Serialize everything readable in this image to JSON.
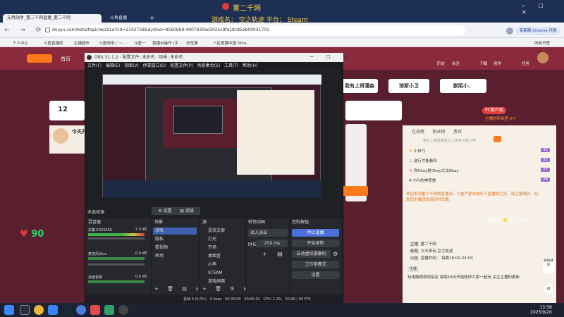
{
  "browser": {
    "tabs": [
      {
        "label": "无燃战争_董二千网直播_董二千网",
        "active": true
      },
      {
        "label": "斗鱼直播",
        "active": false
      }
    ],
    "url": "douyu.com/beta/topic/wjzz1a?rid=2142758&dyshid=85606b8-4907930ac5025c9fa18c85ab00031701",
    "profile_label": "有新版 Chrome 可用",
    "bookmarks": [
      "个人中心",
      "斗鱼直播间",
      "主播超市",
      "斗鱼网络 | '~'...",
      "斗鱼一",
      "我播云操作 (手...",
      "浏览器",
      "八位室播中国 XPro...",
      "所有书签"
    ]
  },
  "overlay": {
    "brand": "董二千网",
    "line": "游戏名： 空之轨迹 平台： Steam"
  },
  "douyu": {
    "nav": {
      "home": "首页",
      "right_icons": [
        "历史",
        "关注",
        "下载",
        "创作",
        "任务"
      ]
    },
    "tags": [
      "我有上将潘森",
      "琼斯小卫",
      "默陌小、"
    ],
    "room_title": "今天开",
    "room_count": "12",
    "room_id_badge": "PC客户端",
    "side_label": "主播的粉丝团 0/7",
    "heart_count": "90",
    "side_heart": "90"
  },
  "obs": {
    "title": "OBS 31.1.2 - 配置文件: 未命名 - 场景: 未命名",
    "menu": [
      "文件(F)",
      "编辑(E)",
      "视图(V)",
      "停靠窗口(D)",
      "配置文件(P)",
      "场景集合(S)",
      "工具(T)",
      "帮助(H)"
    ],
    "preview_status": "未选择源",
    "props_btn": "设置",
    "filters_btn": "滤镜",
    "docks": {
      "mixer": "混音器",
      "scenes": "场景",
      "sources": "源",
      "transitions": "转场动画",
      "controls": "控制按钮"
    },
    "mixer": [
      {
        "name": "采集卡SSSSSS",
        "db": "-7.0 dB"
      },
      {
        "name": "麦克风/Aux",
        "db": "0.0 dB"
      },
      {
        "name": "桌面音频",
        "db": "0.0 dB"
      }
    ],
    "scenes": [
      "游戏",
      "隐私",
      "看视频",
      "转场"
    ],
    "sources": [
      "混流文案",
      "灯光",
      "开场",
      "桌面音",
      "心率",
      "STEAM",
      "游戏画面"
    ],
    "transition": {
      "type": "淡入淡出",
      "duration_label": "时长",
      "duration": "250 ms"
    },
    "controls": [
      "停止直播",
      "开始录制",
      "启动虚拟摄像机",
      "工作室模式",
      "设置"
    ],
    "statusbar": {
      "dropped": "丢帧 0 (0.0%)",
      "bitrate": "0 kbps",
      "rec": "00:00:00",
      "live": "00:00:02",
      "cpu": "CPU: 1.1%",
      "fps": "60.00 / 60 FPS"
    }
  },
  "chat": {
    "tabs": [
      "在线榜",
      "粉丝榜",
      "贵宾"
    ],
    "header": "用户上榜需满足以上条件才能上榜",
    "ranks": [
      {
        "name": "小白勺·",
        "lvl": "43"
      },
      {
        "name": "送行才能看到",
        "lvl": "32"
      },
      {
        "name": "你Okay是Okay大派Okay",
        "lvl": "27"
      },
      {
        "name": "小叶的神思想",
        "lvl": "26"
      }
    ],
    "welcome": "欢迎来到董二千网的直播间。斗鱼严禁未成年人直播或打赏。请注意辨别，如发现主播违规请及时举报。",
    "gift_text": "赠送出",
    "gift_name": "大气 x 1",
    "messages": [
      {
        "user": "主播",
        "text": "董二千网"
      },
      {
        "user": "标题",
        "text": "今天来玩 空之轨迹"
      },
      {
        "user": "公告",
        "text": "直播时间： 每晚18:00-24:00"
      }
    ],
    "bottom_user": "主播",
    "bottom_text": "玩电脑把游戏搞定 每晚18点开始陪伴大家一起玩 关注主播的更新",
    "side_btn": "跟随播放"
  },
  "taskbar": {
    "time": "13:58",
    "date": "2025/9/20"
  },
  "colors": {
    "douyu_red": "#8a2a3a",
    "obs_bg": "#1f2024",
    "accent_orange": "#ff7a1a",
    "obs_button_blue": "#4c6fd9"
  }
}
